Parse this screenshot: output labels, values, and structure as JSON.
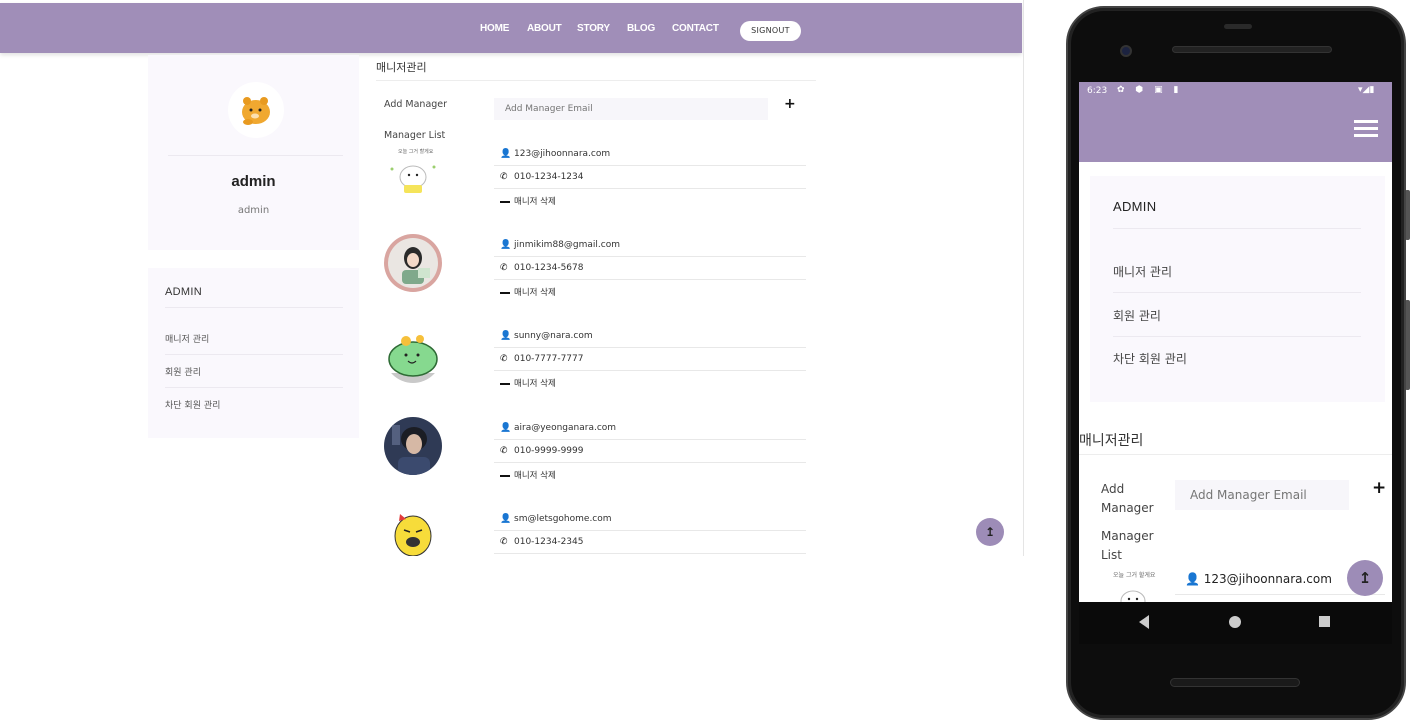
{
  "nav": {
    "links": [
      "HOME",
      "ABOUT",
      "STORY",
      "BLOG",
      "CONTACT"
    ],
    "signout": "SIGNOUT"
  },
  "profile": {
    "name": "admin",
    "role": "admin"
  },
  "sidebar": {
    "title": "ADMIN",
    "items": [
      "매니저 관리",
      "회원 관리",
      "차단 회원 관리"
    ]
  },
  "main": {
    "title": "매니저관리",
    "add_label": "Add Manager",
    "add_placeholder": "Add Manager Email",
    "add_button": "+",
    "list_label": "Manager List",
    "delete_label": "매니저 삭제",
    "managers": [
      {
        "email": "123@jihoonnara.com",
        "phone": "010-1234-1234"
      },
      {
        "email": "jinmikim88@gmail.com",
        "phone": "010-1234-5678"
      },
      {
        "email": "sunny@nara.com",
        "phone": "010-7777-7777"
      },
      {
        "email": "aira@yeonganara.com",
        "phone": "010-9999-9999"
      },
      {
        "email": "sm@letsgohome.com",
        "phone": "010-1234-2345"
      }
    ]
  },
  "mobile": {
    "status_time": "6:23",
    "status_icons": "✿ ⬢ ▣ ▮",
    "status_right": "▾◢▮",
    "sidebar_title": "ADMIN",
    "sidebar_items": [
      "매니저 관리",
      "회원 관리",
      "차단 회원 관리"
    ],
    "section_title": "매니저관리",
    "add_label": "Add Manager",
    "add_placeholder": "Add Manager Email",
    "add_button": "+",
    "list_label": "Manager List",
    "first_email": "123@jihoonnara.com"
  },
  "colors": {
    "accent": "#a08eb8",
    "card_bg": "#faf8fd"
  }
}
